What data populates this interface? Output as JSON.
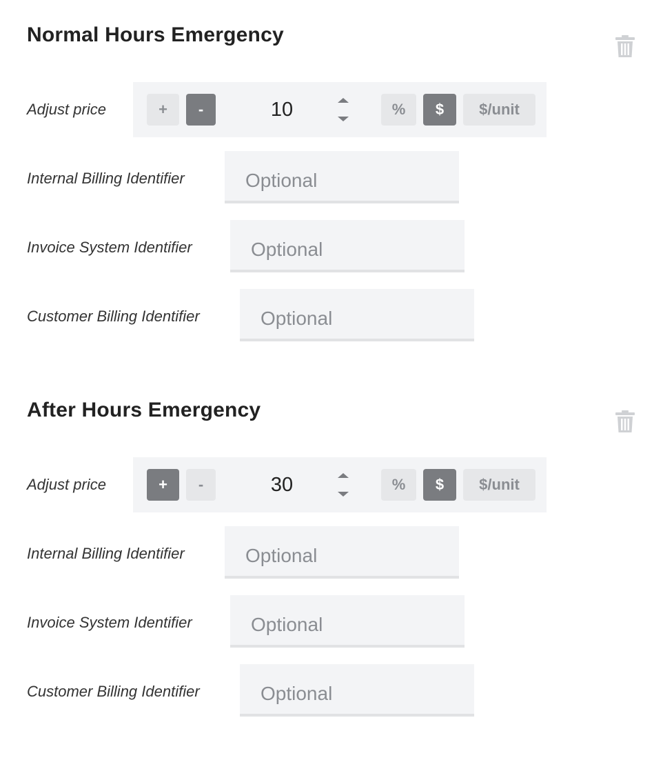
{
  "sections": [
    {
      "title": "Normal Hours Emergency",
      "adjust_label": "Adjust price",
      "plus_label": "+",
      "minus_label": "-",
      "value": "10",
      "pct_label": "%",
      "dollar_label": "$",
      "perunit_label": "$/unit",
      "selected_sign": "minus",
      "selected_unit": "dollar",
      "internal_label": "Internal Billing Identifier",
      "invoice_label": "Invoice System Identifier",
      "customer_label": "Customer Billing Identifier",
      "placeholder": "Optional"
    },
    {
      "title": "After Hours Emergency",
      "adjust_label": "Adjust price",
      "plus_label": "+",
      "minus_label": "-",
      "value": "30",
      "pct_label": "%",
      "dollar_label": "$",
      "perunit_label": "$/unit",
      "selected_sign": "plus",
      "selected_unit": "dollar",
      "internal_label": "Internal Billing Identifier",
      "invoice_label": "Invoice System Identifier",
      "customer_label": "Customer Billing Identifier",
      "placeholder": "Optional"
    }
  ],
  "icons": {
    "delete": "trash-icon",
    "spinner": "up-down-arrows-icon"
  },
  "colors": {
    "active_button": "#7a7c80",
    "inactive_button": "#e6e7e9",
    "panel_background": "#f3f4f6",
    "muted_text": "#8a8d92"
  }
}
